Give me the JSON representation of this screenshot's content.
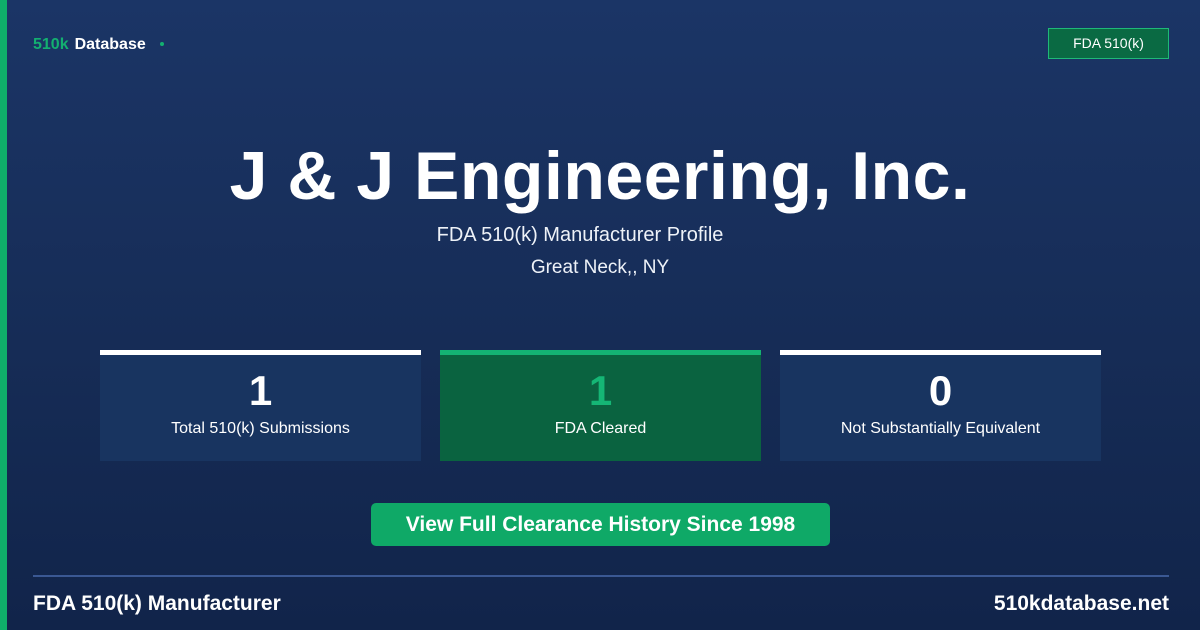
{
  "header": {
    "brand_accent": "510k",
    "brand_name": "Database",
    "badge_label": "FDA 510(k)"
  },
  "profile": {
    "company_name": "J & J Engineering, Inc.",
    "subtitle": "FDA 510(k) Manufacturer Profile",
    "location": "Great Neck,, NY"
  },
  "stats": [
    {
      "value": "1",
      "label": "Total 510(k) Submissions"
    },
    {
      "value": "1",
      "label": "FDA Cleared"
    },
    {
      "value": "0",
      "label": "Not Substantially Equivalent"
    }
  ],
  "cta": {
    "label": "View Full Clearance History Since 1998"
  },
  "footer": {
    "left_label": "FDA 510(k) Manufacturer",
    "right_label": "510kdatabase.net"
  },
  "colors": {
    "background": "#1b3566",
    "accent_green": "#13b070",
    "highlight_card": "#0a6340",
    "cta_button": "#0fa967"
  }
}
